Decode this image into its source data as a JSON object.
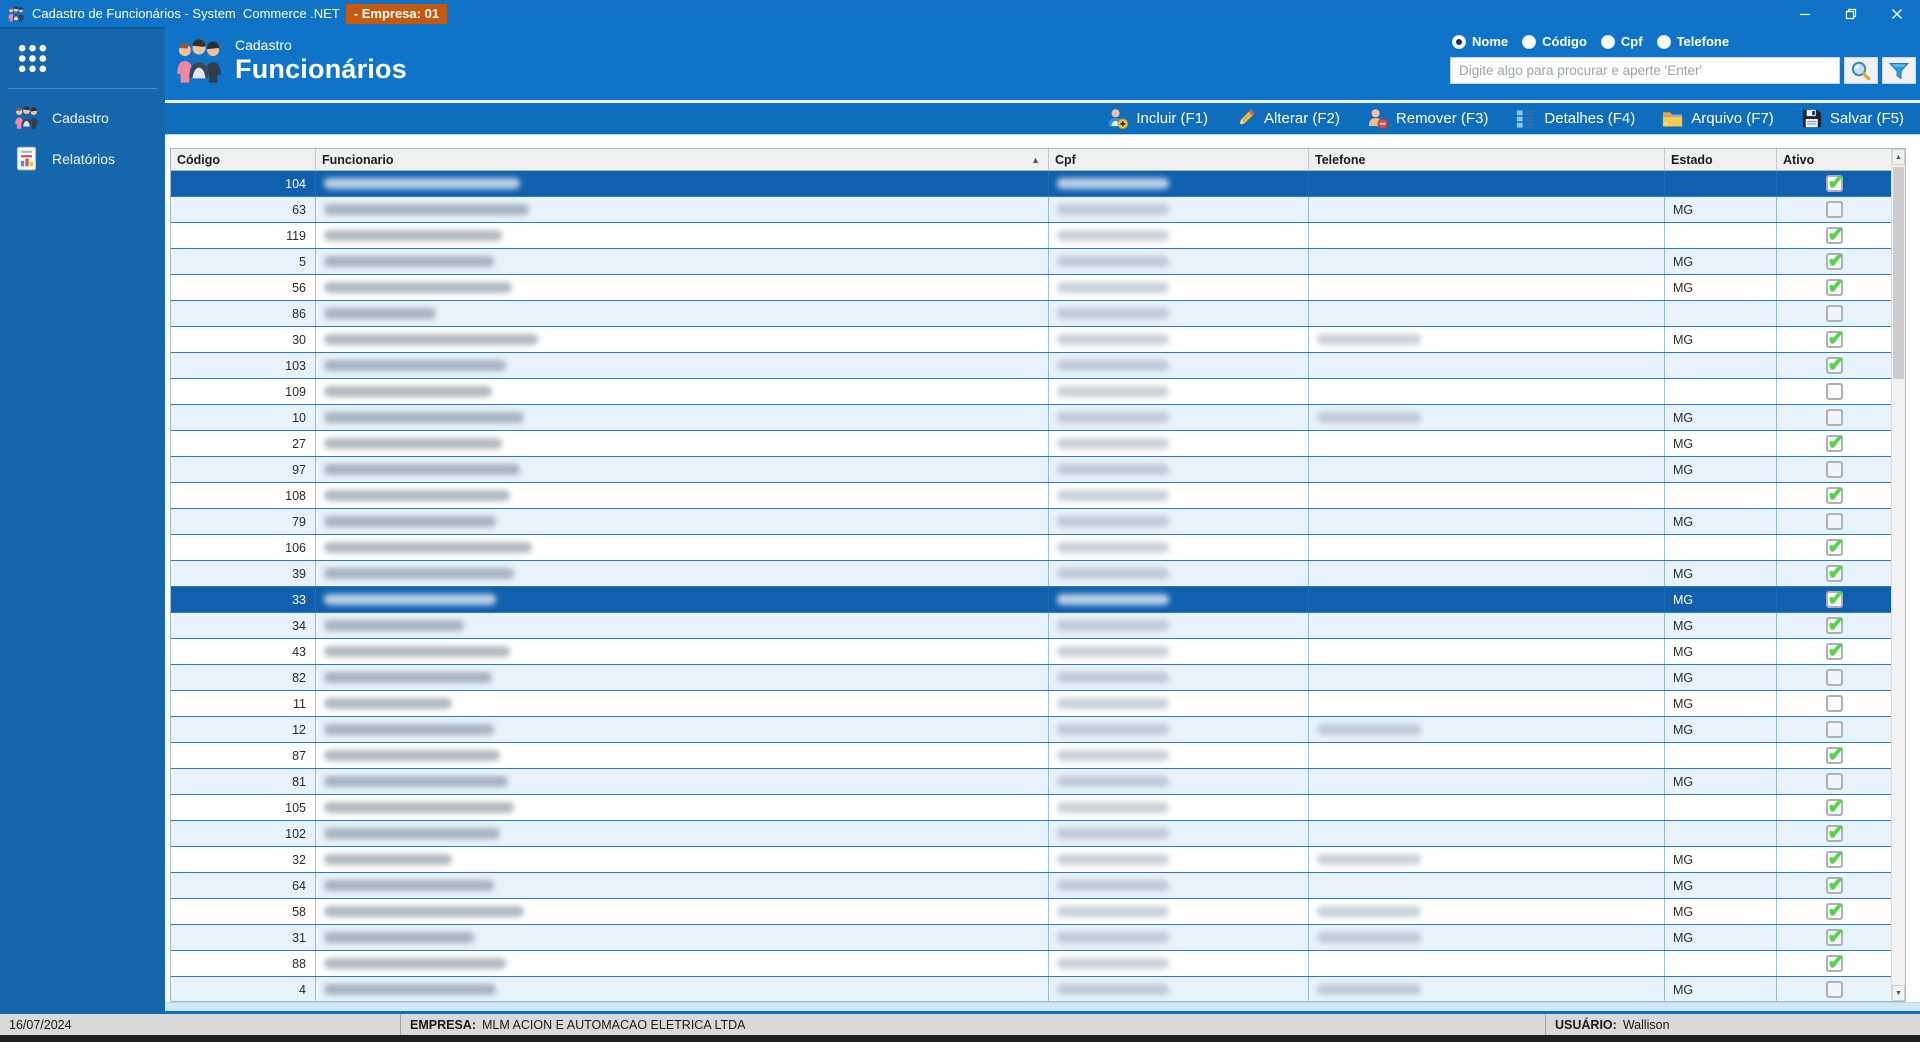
{
  "colors": {
    "titlebar_blue": "#0f72c4",
    "sidebar_blue": "#1566ab",
    "header_blue": "#0f74c8",
    "toolbar_blue": "#0e6ebd",
    "empresa_badge_orange": "#c4590f",
    "selected_row_blue": "#1160ae",
    "alt_row_blue": "#e7f2fa",
    "grid_line_blue": "#2e79bd",
    "check_green": "#5bd349",
    "statusbar_gray": "#d9d9d9"
  },
  "window": {
    "title": "Cadastro de Funcionários - System  Commerce .NET",
    "empresa_badge": "- Empresa: 01"
  },
  "sidebar": {
    "items": [
      {
        "label": "Cadastro",
        "icon": "people-icon"
      },
      {
        "label": "Relatórios",
        "icon": "report-icon"
      }
    ]
  },
  "header": {
    "breadcrumb": "Cadastro",
    "title": "Funcionários",
    "search_modes": [
      {
        "label": "Nome",
        "selected": true
      },
      {
        "label": "Código",
        "selected": false
      },
      {
        "label": "Cpf",
        "selected": false
      },
      {
        "label": "Telefone",
        "selected": false
      }
    ],
    "search_placeholder": "Digite algo para procurar e aperte 'Enter'"
  },
  "toolbar": {
    "buttons": [
      {
        "label": "Incluir (F1)",
        "icon": "person-add-icon"
      },
      {
        "label": "Alterar (F2)",
        "icon": "pencil-icon"
      },
      {
        "label": "Remover (F3)",
        "icon": "person-remove-icon"
      },
      {
        "label": "Detalhes (F4)",
        "icon": "details-icon"
      },
      {
        "label": "Arquivo (F7)",
        "icon": "folder-icon"
      },
      {
        "label": "Salvar (F5)",
        "icon": "floppy-icon"
      }
    ]
  },
  "grid": {
    "columns": [
      "Código",
      "Funcionario",
      "Cpf",
      "Telefone",
      "Estado",
      "Ativo"
    ],
    "sort_column": "Funcionario",
    "sort_direction": "asc",
    "redaction": {
      "cpf_w": 112,
      "tel_w": 104
    },
    "rows": [
      {
        "codigo": 104,
        "name_w": 196,
        "estado": "",
        "ativo": true,
        "selected": true,
        "telefone_redacted": false
      },
      {
        "codigo": 63,
        "name_w": 205,
        "estado": "MG",
        "ativo": false,
        "selected": false,
        "telefone_redacted": false
      },
      {
        "codigo": 119,
        "name_w": 178,
        "estado": "",
        "ativo": true,
        "selected": false,
        "telefone_redacted": false
      },
      {
        "codigo": 5,
        "name_w": 170,
        "estado": "MG",
        "ativo": true,
        "selected": false,
        "telefone_redacted": false
      },
      {
        "codigo": 56,
        "name_w": 188,
        "estado": "MG",
        "ativo": true,
        "selected": false,
        "telefone_redacted": false
      },
      {
        "codigo": 86,
        "name_w": 112,
        "estado": "",
        "ativo": false,
        "selected": false,
        "telefone_redacted": false
      },
      {
        "codigo": 30,
        "name_w": 214,
        "estado": "MG",
        "ativo": true,
        "selected": false,
        "telefone_redacted": true
      },
      {
        "codigo": 103,
        "name_w": 182,
        "estado": "",
        "ativo": true,
        "selected": false,
        "telefone_redacted": false
      },
      {
        "codigo": 109,
        "name_w": 168,
        "estado": "",
        "ativo": false,
        "selected": false,
        "telefone_redacted": false
      },
      {
        "codigo": 10,
        "name_w": 200,
        "estado": "MG",
        "ativo": false,
        "selected": false,
        "telefone_redacted": true
      },
      {
        "codigo": 27,
        "name_w": 178,
        "estado": "MG",
        "ativo": true,
        "selected": false,
        "telefone_redacted": false
      },
      {
        "codigo": 97,
        "name_w": 196,
        "estado": "MG",
        "ativo": false,
        "selected": false,
        "telefone_redacted": false
      },
      {
        "codigo": 108,
        "name_w": 186,
        "estado": "",
        "ativo": true,
        "selected": false,
        "telefone_redacted": false
      },
      {
        "codigo": 79,
        "name_w": 172,
        "estado": "MG",
        "ativo": false,
        "selected": false,
        "telefone_redacted": false
      },
      {
        "codigo": 106,
        "name_w": 208,
        "estado": "",
        "ativo": true,
        "selected": false,
        "telefone_redacted": false
      },
      {
        "codigo": 39,
        "name_w": 190,
        "estado": "MG",
        "ativo": true,
        "selected": false,
        "telefone_redacted": false
      },
      {
        "codigo": 33,
        "name_w": 172,
        "estado": "MG",
        "ativo": true,
        "selected": true,
        "telefone_redacted": false
      },
      {
        "codigo": 34,
        "name_w": 140,
        "estado": "MG",
        "ativo": true,
        "selected": false,
        "telefone_redacted": false
      },
      {
        "codigo": 43,
        "name_w": 186,
        "estado": "MG",
        "ativo": true,
        "selected": false,
        "telefone_redacted": false
      },
      {
        "codigo": 82,
        "name_w": 168,
        "estado": "MG",
        "ativo": false,
        "selected": false,
        "telefone_redacted": false
      },
      {
        "codigo": 11,
        "name_w": 128,
        "estado": "MG",
        "ativo": false,
        "selected": false,
        "telefone_redacted": false
      },
      {
        "codigo": 12,
        "name_w": 170,
        "estado": "MG",
        "ativo": false,
        "selected": false,
        "telefone_redacted": true
      },
      {
        "codigo": 87,
        "name_w": 176,
        "estado": "",
        "ativo": true,
        "selected": false,
        "telefone_redacted": false
      },
      {
        "codigo": 81,
        "name_w": 184,
        "estado": "MG",
        "ativo": false,
        "selected": false,
        "telefone_redacted": false
      },
      {
        "codigo": 105,
        "name_w": 190,
        "estado": "",
        "ativo": true,
        "selected": false,
        "telefone_redacted": false
      },
      {
        "codigo": 102,
        "name_w": 176,
        "estado": "",
        "ativo": true,
        "selected": false,
        "telefone_redacted": false
      },
      {
        "codigo": 32,
        "name_w": 128,
        "estado": "MG",
        "ativo": true,
        "selected": false,
        "telefone_redacted": true
      },
      {
        "codigo": 64,
        "name_w": 170,
        "estado": "MG",
        "ativo": true,
        "selected": false,
        "telefone_redacted": false
      },
      {
        "codigo": 58,
        "name_w": 200,
        "estado": "MG",
        "ativo": true,
        "selected": false,
        "telefone_redacted": true
      },
      {
        "codigo": 31,
        "name_w": 150,
        "estado": "MG",
        "ativo": true,
        "selected": false,
        "telefone_redacted": true
      },
      {
        "codigo": 88,
        "name_w": 182,
        "estado": "",
        "ativo": true,
        "selected": false,
        "telefone_redacted": false
      },
      {
        "codigo": 4,
        "name_w": 172,
        "estado": "MG",
        "ativo": false,
        "selected": false,
        "telefone_redacted": true
      }
    ]
  },
  "statusbar": {
    "date": "16/07/2024",
    "empresa_label": "EMPRESA:",
    "empresa": "MLM ACION E AUTOMACAO ELETRICA LTDA",
    "usuario_label": "USUÁRIO:",
    "usuario": "Wallison"
  }
}
